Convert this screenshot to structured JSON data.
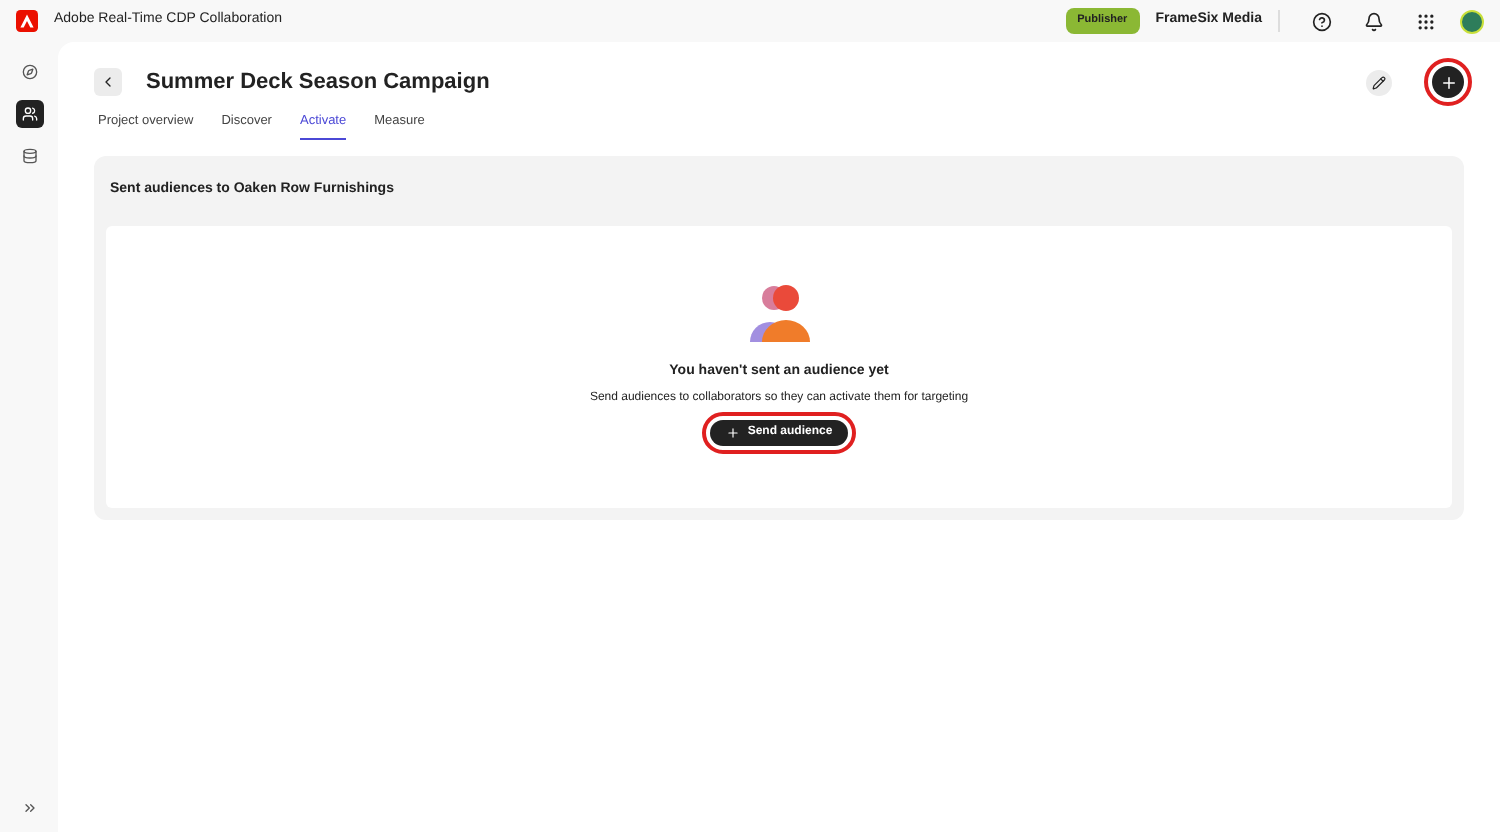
{
  "app_title": "Adobe Real-Time CDP Collaboration",
  "header": {
    "role_badge": "Publisher",
    "organization": "FrameSix Media"
  },
  "sidebar": {
    "items": [
      {
        "kind": "compass",
        "selected": false
      },
      {
        "kind": "audience",
        "selected": true
      },
      {
        "kind": "database",
        "selected": false
      }
    ]
  },
  "page": {
    "title": "Summer Deck Season Campaign"
  },
  "tabs": [
    {
      "label": "Project overview",
      "selected": false
    },
    {
      "label": "Discover",
      "selected": false
    },
    {
      "label": "Activate",
      "selected": true
    },
    {
      "label": "Measure",
      "selected": false
    }
  ],
  "section": {
    "title": "Sent audiences to Oaken Row Furnishings",
    "empty_title": "You haven't sent an audience yet",
    "empty_text": "Send audiences to collaborators so they can activate them for targeting",
    "button": "Send audience"
  }
}
